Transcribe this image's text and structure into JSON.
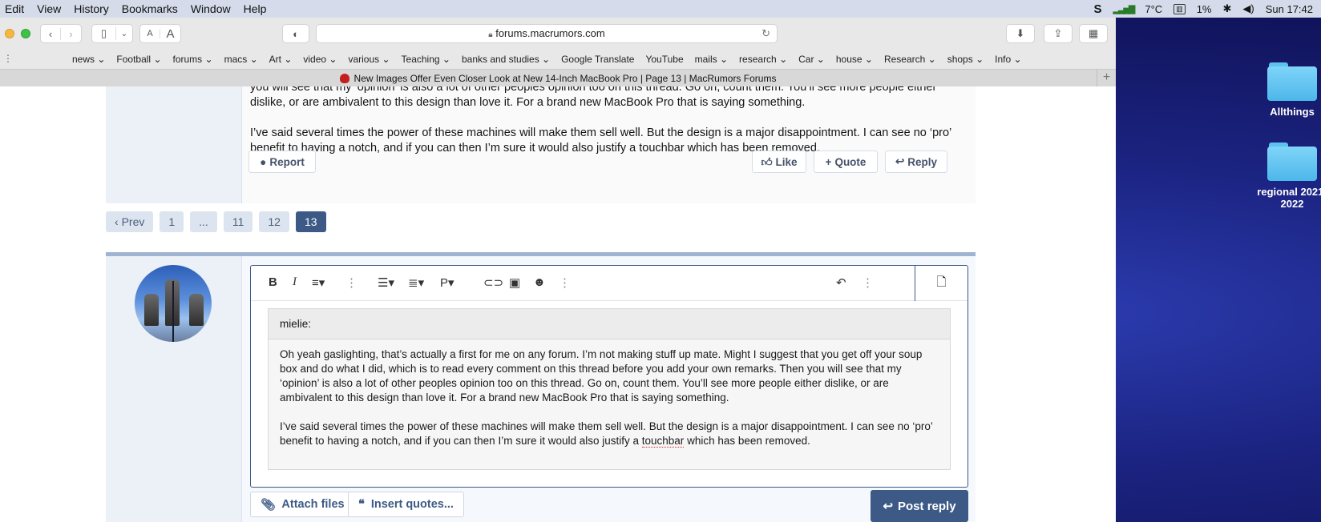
{
  "menubar": {
    "items": [
      "Edit",
      "View",
      "History",
      "Bookmarks",
      "Window",
      "Help"
    ],
    "status": {
      "temperature": "7°C",
      "battery": "1%",
      "clock": "Sun 17:42"
    }
  },
  "browser": {
    "url": "forums.macrumors.com",
    "text_small_a": "A",
    "text_large_a": "A",
    "bookmarks": [
      "news",
      "Football",
      "forums",
      "macs",
      "Art",
      "video",
      "various",
      "Teaching",
      "banks and studies",
      "Google Translate",
      "YouTube",
      "mails",
      "research",
      "Car",
      "house",
      "Research",
      "shops",
      "Info"
    ],
    "bookmark_has_dropdown": [
      true,
      true,
      true,
      true,
      true,
      true,
      true,
      true,
      true,
      false,
      false,
      true,
      true,
      true,
      true,
      true,
      true,
      true
    ],
    "tab_title": "New Images Offer Even Closer Look at New 14-Inch MacBook Pro | Page 13 | MacRumors Forums"
  },
  "post": {
    "para1_tail": "you will see that my ‘opinion’ is also a lot of other peoples opinion too on this thread. Go on, count them. You’ll see more people either dislike, or are ambivalent to this design than love it. For a brand new MacBook Pro that is saying something.",
    "para2": "I’ve said several times the power of these machines will make them sell well. But the design is a major disappointment. I can see no ‘pro’ benefit to having a notch, and if you can then I’m sure it would also justify a touchbar which has been removed.",
    "report_label": "Report",
    "like_label": "Like",
    "quote_label": "Quote",
    "reply_label": "Reply"
  },
  "pager": {
    "prev_label": "Prev",
    "pages": [
      "1",
      "...",
      "11",
      "12",
      "13"
    ],
    "active_page": "13"
  },
  "editor": {
    "quote_author": "mielie:",
    "quote_para1": "Oh yeah gaslighting, that’s actually a first for me on any forum. I’m not making stuff up mate. Might I suggest that you get off your soup box and do what I did, which is to read every comment on this thread before you add your own remarks. Then you will see that my ‘opinion’ is also a lot of other peoples opinion too on this thread. Go on, count them. You’ll see more people either dislike, or are ambivalent to this design than love it. For a brand new MacBook Pro that is saying something.",
    "quote_para2_before": "I’ve said several times the power of these machines will make them sell well. But the design is a major disappointment. I can see no ‘pro’ benefit to having a notch, and if you can then I’m sure it would also justify a ",
    "quote_para2_misspelled": "touchbar",
    "quote_para2_after": " which has been removed.",
    "attach_label": "Attach files",
    "insert_quotes_label": "Insert quotes...",
    "post_reply_label": "Post reply"
  },
  "desktop": {
    "icons": [
      "Allthings",
      "regional 2021-2022"
    ]
  },
  "colors": {
    "accent": "#3d5a86",
    "page_bg": "#ecf1f8",
    "desktop": "#1b2380"
  }
}
